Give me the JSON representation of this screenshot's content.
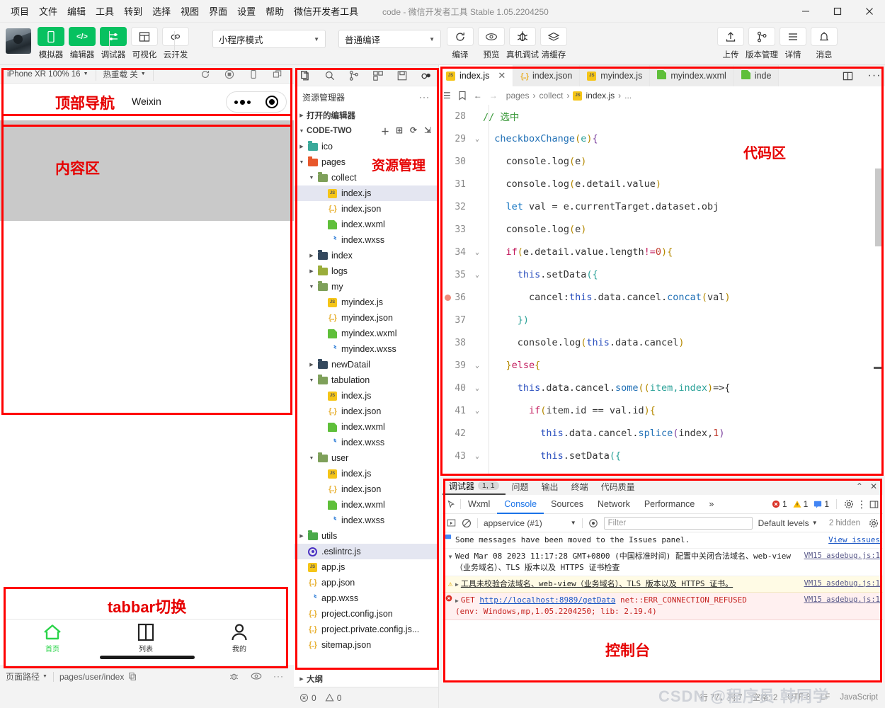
{
  "window": {
    "menu": [
      "项目",
      "文件",
      "编辑",
      "工具",
      "转到",
      "选择",
      "视图",
      "界面",
      "设置",
      "帮助",
      "微信开发者工具"
    ],
    "title": "code - 微信开发者工具 Stable 1.05.2204250",
    "minimize": "—",
    "maximize": "▢",
    "close": "✕"
  },
  "toolbar": {
    "buttons": [
      {
        "label": "模拟器",
        "icon": "phone-icon",
        "green": true
      },
      {
        "label": "编辑器",
        "icon": "code-icon",
        "green": true
      },
      {
        "label": "调试器",
        "icon": "debug-sliders-icon",
        "green": true
      },
      {
        "label": "可视化",
        "icon": "layout-icon",
        "green": false
      },
      {
        "label": "云开发",
        "icon": "cloud-icon",
        "green": false
      }
    ],
    "mode_select": "小程序模式",
    "compile_select": "普通编译",
    "right_buttons": [
      {
        "label": "编译",
        "icon": "refresh-icon"
      },
      {
        "label": "预览",
        "icon": "eye-icon"
      },
      {
        "label": "真机调试",
        "icon": "bug-icon"
      },
      {
        "label": "清缓存",
        "icon": "layers-icon"
      }
    ],
    "far_right_buttons": [
      {
        "label": "上传",
        "icon": "upload-icon"
      },
      {
        "label": "版本管理",
        "icon": "branch-icon"
      },
      {
        "label": "详情",
        "icon": "menu-icon"
      },
      {
        "label": "消息",
        "icon": "bell-icon"
      }
    ]
  },
  "simulator": {
    "device": "iPhone XR 100% 16",
    "hot_reload": "热重载 关",
    "toolbar_icons": [
      "refresh-icon",
      "record-icon",
      "rotate-device-icon",
      "popout-icon"
    ],
    "nav_label": "顶部导航",
    "nav_title": "Weixin",
    "content_label": "内容区",
    "tabbar_label": "tabbar切换",
    "tabbar": [
      {
        "label": "首页",
        "icon": "home-icon",
        "active": true
      },
      {
        "label": "列表",
        "icon": "list-icon",
        "active": false
      },
      {
        "label": "我的",
        "icon": "person-icon",
        "active": false
      }
    ],
    "footer": {
      "path_label": "页面路径",
      "path_value": "pages/user/index",
      "icons": [
        "bug-icon",
        "eye-icon",
        "more-icon"
      ]
    }
  },
  "explorer": {
    "top_icons": [
      "files-icon",
      "search-icon",
      "source-control-icon",
      "extensions-icon",
      "save-icon",
      "cloud-icon"
    ],
    "title": "资源管理器",
    "more": "···",
    "open_editors": "打开的编辑器",
    "project_name": "CODE-TWO",
    "project_actions": [
      "new-file-icon",
      "new-folder-icon",
      "refresh-icon",
      "collapse-icon"
    ],
    "annotation": "资源管理",
    "outline": "大纲",
    "status": {
      "errors": "0",
      "warnings": "0"
    },
    "tree": [
      {
        "name": "ico",
        "type": "folder",
        "indent": 1,
        "expanded": false,
        "color": "#3aa99a"
      },
      {
        "name": "pages",
        "type": "folder",
        "indent": 1,
        "expanded": true,
        "color": "#e8572b"
      },
      {
        "name": "collect",
        "type": "folder",
        "indent": 2,
        "expanded": true,
        "color": "#7ea05a"
      },
      {
        "name": "index.js",
        "type": "js",
        "indent": 3,
        "selected": true
      },
      {
        "name": "index.json",
        "type": "json",
        "indent": 3
      },
      {
        "name": "index.wxml",
        "type": "wxml",
        "indent": 3
      },
      {
        "name": "index.wxss",
        "type": "wxss",
        "indent": 3
      },
      {
        "name": "index",
        "type": "folder",
        "indent": 2,
        "expanded": false,
        "color": "#34495e"
      },
      {
        "name": "logs",
        "type": "folder",
        "indent": 2,
        "expanded": false,
        "color": "#9aad3a"
      },
      {
        "name": "my",
        "type": "folder",
        "indent": 2,
        "expanded": true,
        "color": "#7ea05a"
      },
      {
        "name": "myindex.js",
        "type": "js",
        "indent": 3
      },
      {
        "name": "myindex.json",
        "type": "json",
        "indent": 3
      },
      {
        "name": "myindex.wxml",
        "type": "wxml",
        "indent": 3
      },
      {
        "name": "myindex.wxss",
        "type": "wxss",
        "indent": 3
      },
      {
        "name": "newDatail",
        "type": "folder",
        "indent": 2,
        "expanded": false,
        "color": "#34495e"
      },
      {
        "name": "tabulation",
        "type": "folder",
        "indent": 2,
        "expanded": true,
        "color": "#7ea05a"
      },
      {
        "name": "index.js",
        "type": "js",
        "indent": 3
      },
      {
        "name": "index.json",
        "type": "json",
        "indent": 3
      },
      {
        "name": "index.wxml",
        "type": "wxml",
        "indent": 3
      },
      {
        "name": "index.wxss",
        "type": "wxss",
        "indent": 3
      },
      {
        "name": "user",
        "type": "folder",
        "indent": 2,
        "expanded": true,
        "color": "#7ea05a"
      },
      {
        "name": "index.js",
        "type": "js",
        "indent": 3
      },
      {
        "name": "index.json",
        "type": "json",
        "indent": 3
      },
      {
        "name": "index.wxml",
        "type": "wxml",
        "indent": 3
      },
      {
        "name": "index.wxss",
        "type": "wxss",
        "indent": 3
      },
      {
        "name": "utils",
        "type": "folder",
        "indent": 1,
        "expanded": false,
        "color": "#4aa94a"
      },
      {
        "name": ".eslintrc.js",
        "type": "eslint",
        "indent": 1,
        "selected": true
      },
      {
        "name": "app.js",
        "type": "js",
        "indent": 1
      },
      {
        "name": "app.json",
        "type": "json",
        "indent": 1
      },
      {
        "name": "app.wxss",
        "type": "wxss",
        "indent": 1
      },
      {
        "name": "project.config.json",
        "type": "json",
        "indent": 1
      },
      {
        "name": "project.private.config.js...",
        "type": "json",
        "indent": 1
      },
      {
        "name": "sitemap.json",
        "type": "json",
        "indent": 1
      }
    ]
  },
  "editor": {
    "tabs": [
      {
        "label": "index.js",
        "type": "js",
        "active": true,
        "closable": true
      },
      {
        "label": "index.json",
        "type": "json",
        "active": false
      },
      {
        "label": "myindex.js",
        "type": "js",
        "active": false
      },
      {
        "label": "myindex.wxml",
        "type": "wxml",
        "active": false
      },
      {
        "label": "inde",
        "type": "wxml",
        "active": false
      }
    ],
    "tab_actions": [
      "split-editor-icon",
      "more-icon"
    ],
    "breadcrumb": [
      "pages",
      "collect",
      "index.js",
      "..."
    ],
    "breadcrumb_nav": [
      "list-icon",
      "bookmark-icon",
      "back-arrow-icon",
      "forward-arrow-icon"
    ],
    "annotation": "代码区",
    "code_lines": [
      {
        "num": "28",
        "fold": "",
        "bp": false,
        "indent": 0,
        "tokens": [
          {
            "t": "// 选中",
            "c": "k-com"
          }
        ]
      },
      {
        "num": "29",
        "fold": "v",
        "bp": false,
        "indent": 1,
        "tokens": [
          {
            "t": "checkboxChange",
            "c": "k-fn"
          },
          {
            "t": "(",
            "c": "k-par"
          },
          {
            "t": "e",
            "c": "k-par3"
          },
          {
            "t": ")",
            "c": "k-par"
          },
          {
            "t": "{",
            "c": "k-par2"
          }
        ]
      },
      {
        "num": "30",
        "fold": "",
        "bp": false,
        "indent": 2,
        "tokens": [
          {
            "t": "console",
            "c": "k-prop"
          },
          {
            "t": ".",
            "c": "k-prop"
          },
          {
            "t": "log",
            "c": "k-prop"
          },
          {
            "t": "(",
            "c": "k-par"
          },
          {
            "t": "e",
            "c": "k-prop"
          },
          {
            "t": ")",
            "c": "k-par"
          }
        ]
      },
      {
        "num": "31",
        "fold": "",
        "bp": false,
        "indent": 2,
        "tokens": [
          {
            "t": "console",
            "c": "k-prop"
          },
          {
            "t": ".",
            "c": "k-prop"
          },
          {
            "t": "log",
            "c": "k-prop"
          },
          {
            "t": "(",
            "c": "k-par"
          },
          {
            "t": "e.detail.value",
            "c": "k-prop"
          },
          {
            "t": ")",
            "c": "k-par"
          }
        ]
      },
      {
        "num": "32",
        "fold": "",
        "bp": false,
        "indent": 2,
        "tokens": [
          {
            "t": "let",
            "c": "k-let"
          },
          {
            "t": " val = e.currentTarget.dataset.obj",
            "c": "k-prop"
          }
        ]
      },
      {
        "num": "33",
        "fold": "",
        "bp": false,
        "indent": 2,
        "tokens": [
          {
            "t": "console",
            "c": "k-prop"
          },
          {
            "t": ".",
            "c": "k-prop"
          },
          {
            "t": "log",
            "c": "k-prop"
          },
          {
            "t": "(",
            "c": "k-par"
          },
          {
            "t": "e",
            "c": "k-prop"
          },
          {
            "t": ")",
            "c": "k-par"
          }
        ]
      },
      {
        "num": "34",
        "fold": "v",
        "bp": false,
        "indent": 2,
        "tokens": [
          {
            "t": "if",
            "c": "k-pink"
          },
          {
            "t": "(",
            "c": "k-par"
          },
          {
            "t": "e.detail.value.length",
            "c": "k-prop"
          },
          {
            "t": "!=",
            "c": "k-pink"
          },
          {
            "t": "0",
            "c": "k-num"
          },
          {
            "t": ")",
            "c": "k-par"
          },
          {
            "t": "{",
            "c": "k-par"
          }
        ]
      },
      {
        "num": "35",
        "fold": "v",
        "bp": false,
        "indent": 3,
        "tokens": [
          {
            "t": "this",
            "c": "k-this"
          },
          {
            "t": ".setData",
            "c": "k-prop"
          },
          {
            "t": "(",
            "c": "k-par3"
          },
          {
            "t": "{",
            "c": "k-par3"
          }
        ]
      },
      {
        "num": "36",
        "fold": "",
        "bp": true,
        "indent": 4,
        "tokens": [
          {
            "t": "cancel:",
            "c": "k-prop"
          },
          {
            "t": "this",
            "c": "k-this"
          },
          {
            "t": ".data.cancel.",
            "c": "k-prop"
          },
          {
            "t": "concat",
            "c": "k-fn"
          },
          {
            "t": "(",
            "c": "k-par"
          },
          {
            "t": "val",
            "c": "k-prop"
          },
          {
            "t": ")",
            "c": "k-par"
          }
        ]
      },
      {
        "num": "37",
        "fold": "",
        "bp": false,
        "indent": 3,
        "tokens": [
          {
            "t": "}",
            "c": "k-par3"
          },
          {
            "t": ")",
            "c": "k-par3"
          }
        ]
      },
      {
        "num": "38",
        "fold": "",
        "bp": false,
        "indent": 3,
        "tokens": [
          {
            "t": "console",
            "c": "k-prop"
          },
          {
            "t": ".",
            "c": "k-prop"
          },
          {
            "t": "log",
            "c": "k-prop"
          },
          {
            "t": "(",
            "c": "k-par"
          },
          {
            "t": "this",
            "c": "k-this"
          },
          {
            "t": ".data.cancel",
            "c": "k-prop"
          },
          {
            "t": ")",
            "c": "k-par"
          }
        ]
      },
      {
        "num": "39",
        "fold": "v",
        "bp": false,
        "indent": 2,
        "tokens": [
          {
            "t": "}",
            "c": "k-par"
          },
          {
            "t": "else",
            "c": "k-pink"
          },
          {
            "t": "{",
            "c": "k-par"
          }
        ]
      },
      {
        "num": "40",
        "fold": "v",
        "bp": false,
        "indent": 3,
        "tokens": [
          {
            "t": "this",
            "c": "k-this"
          },
          {
            "t": ".data.cancel.",
            "c": "k-prop"
          },
          {
            "t": "some",
            "c": "k-fn"
          },
          {
            "t": "((",
            "c": "k-par"
          },
          {
            "t": "item,index",
            "c": "k-par3"
          },
          {
            "t": ")",
            "c": "k-par"
          },
          {
            "t": "=>{",
            "c": "k-prop"
          }
        ]
      },
      {
        "num": "41",
        "fold": "v",
        "bp": false,
        "indent": 4,
        "tokens": [
          {
            "t": "if",
            "c": "k-pink"
          },
          {
            "t": "(",
            "c": "k-par"
          },
          {
            "t": "item.id == val.id",
            "c": "k-prop"
          },
          {
            "t": ")",
            "c": "k-par"
          },
          {
            "t": "{",
            "c": "k-par"
          }
        ]
      },
      {
        "num": "42",
        "fold": "",
        "bp": false,
        "indent": 5,
        "tokens": [
          {
            "t": "this",
            "c": "k-this"
          },
          {
            "t": ".data.cancel.",
            "c": "k-prop"
          },
          {
            "t": "splice",
            "c": "k-fn"
          },
          {
            "t": "(",
            "c": "k-par2"
          },
          {
            "t": "index",
            "c": "k-prop"
          },
          {
            "t": ",",
            "c": "k-prop"
          },
          {
            "t": "1",
            "c": "k-num"
          },
          {
            "t": ")",
            "c": "k-par2"
          }
        ]
      },
      {
        "num": "43",
        "fold": "v",
        "bp": false,
        "indent": 5,
        "tokens": [
          {
            "t": "this",
            "c": "k-this"
          },
          {
            "t": ".setData",
            "c": "k-prop"
          },
          {
            "t": "(",
            "c": "k-par3"
          },
          {
            "t": "{",
            "c": "k-par3"
          }
        ]
      }
    ]
  },
  "devtools": {
    "panel_tabs": [
      {
        "label": "调试器",
        "badge": "1, 1",
        "active": true
      },
      {
        "label": "问题",
        "badge": "",
        "active": false
      },
      {
        "label": "输出",
        "badge": "",
        "active": false
      },
      {
        "label": "终端",
        "badge": "",
        "active": false
      },
      {
        "label": "代码质量",
        "badge": "",
        "active": false
      }
    ],
    "panel_actions": [
      "collapse-icon",
      "close-icon"
    ],
    "chrome_tabs": [
      "Wxml",
      "Console",
      "Sources",
      "Network",
      "Performance"
    ],
    "chrome_active": "Console",
    "overflow": "»",
    "counts": {
      "errors": "1",
      "warnings": "1",
      "info": "1"
    },
    "right_icons": [
      "gear-icon",
      "kebab-icon",
      "dock-icon"
    ],
    "filter": {
      "context": "appservice (#1)",
      "placeholder": "Filter",
      "levels": "Default levels",
      "hidden": "2 hidden"
    },
    "annotation": "控制台",
    "messages": [
      {
        "type": "info",
        "text": "Some messages have been moved to the Issues panel.",
        "action": "View issues",
        "source": ""
      },
      {
        "type": "log",
        "text": "Wed Mar 08 2023 11:17:28 GMT+0800 (中国标准时间) 配置中关闭合法域名、web-view（业务域名）、TLS 版本以及 HTTPS 证书检查",
        "source": "VM15 asdebug.js:1"
      },
      {
        "type": "warn",
        "text": "工具未校验合法域名、web-view（业务域名）、TLS 版本以及 HTTPS 证书。",
        "source": "VM15 asdebug.js:1"
      },
      {
        "type": "error",
        "prefix": "GET ",
        "link": "http://localhost:8989/getData",
        "text": " net::ERR_CONNECTION_REFUSED",
        "text2": "(env: Windows,mp,1.05.2204250; lib: 2.19.4)",
        "source": "VM15 asdebug.js:1"
      }
    ]
  },
  "statusbar": {
    "position": "行 77，列 7",
    "spaces": "空格: 2",
    "encoding": "UTF-8",
    "eol": "LF",
    "language": "JavaScript"
  },
  "watermark": "CSDN @程序员 韩同学"
}
